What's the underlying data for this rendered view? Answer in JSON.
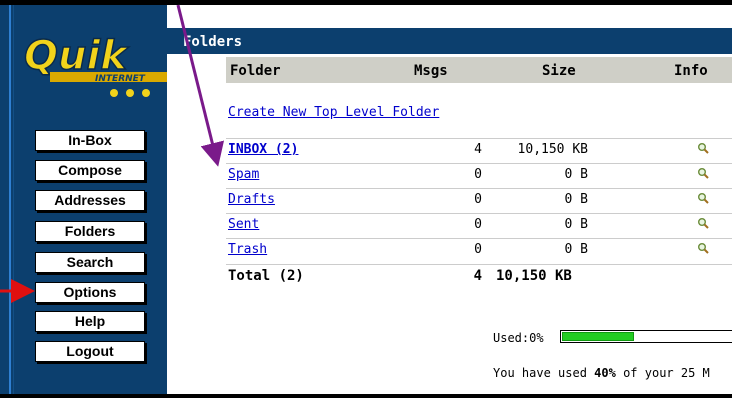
{
  "sidebar": {
    "logo_text": "Quik",
    "logo_subtext": "INTERNET",
    "nav": [
      {
        "label": "In-Box"
      },
      {
        "label": "Compose"
      },
      {
        "label": "Addresses"
      },
      {
        "label": "Folders"
      },
      {
        "label": "Search"
      },
      {
        "label": "Options"
      },
      {
        "label": "Help"
      },
      {
        "label": "Logout"
      }
    ]
  },
  "main": {
    "header": "Folders",
    "columns": {
      "folder": "Folder",
      "msgs": "Msgs",
      "size": "Size",
      "info": "Info"
    },
    "create_link": "Create New Top Level Folder",
    "folders": [
      {
        "name": "INBOX (2)",
        "msgs": "4",
        "size": "10,150 KB",
        "bold": true
      },
      {
        "name": "Spam",
        "msgs": "0",
        "size": "0 B",
        "bold": false
      },
      {
        "name": "Drafts",
        "msgs": "0",
        "size": "0 B",
        "bold": false
      },
      {
        "name": "Sent",
        "msgs": "0",
        "size": "0 B",
        "bold": false
      },
      {
        "name": "Trash",
        "msgs": "0",
        "size": "0 B",
        "bold": false
      }
    ],
    "total": {
      "label": "Total (2)",
      "msgs": "4",
      "size": "10,150 KB"
    },
    "usage": {
      "used_label": "Used:0%",
      "fill_fraction": 0.4,
      "quota_prefix": "You have used ",
      "quota_percent": "40%",
      "quota_suffix": " of your 25 M"
    }
  },
  "colors": {
    "navy": "#0c3f6e",
    "logo_yellow": "#f2d31b",
    "link": "#0000cc",
    "arrow_purple": "#7a1a8a",
    "arrow_red": "#e01010",
    "bar_green": "#22cc22"
  },
  "icons": {
    "info": "magnifier-icon"
  }
}
